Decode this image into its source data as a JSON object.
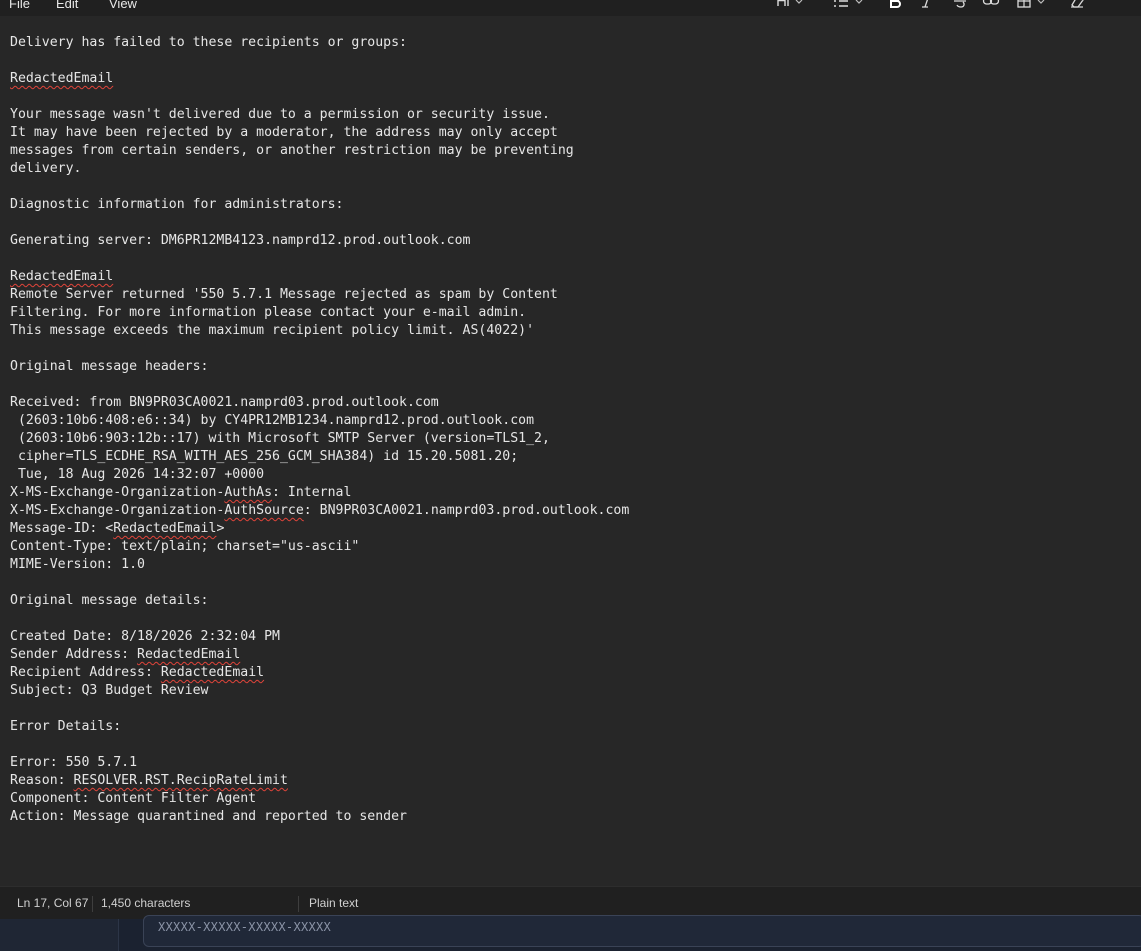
{
  "menu": {
    "file": "File",
    "edit": "Edit",
    "view": "View"
  },
  "toolbar": {
    "heading_icon": "heading-icon",
    "list_icon": "list-icon",
    "bold_icon": "bold-icon",
    "italic_icon": "italic-icon",
    "strikethrough_icon": "strikethrough-icon",
    "link_icon": "link-icon",
    "table_icon": "table-icon",
    "clear_format_icon": "clear-formatting-icon"
  },
  "document": {
    "lines": [
      [
        {
          "t": "Delivery has failed to these recipients or groups:"
        }
      ],
      [],
      [
        {
          "t": "RedactedEmail",
          "sq": true
        }
      ],
      [],
      [
        {
          "t": "Your message wasn't delivered due to a permission or security issue."
        }
      ],
      [
        {
          "t": "It may have been rejected by a moderator, the address may only accept"
        }
      ],
      [
        {
          "t": "messages from certain senders, or another restriction may be preventing"
        }
      ],
      [
        {
          "t": "delivery."
        }
      ],
      [],
      [
        {
          "t": "Diagnostic information for administrators:"
        }
      ],
      [],
      [
        {
          "t": "Generating server: DM6PR12MB4123.namprd12.prod.outlook.com"
        }
      ],
      [],
      [
        {
          "t": "RedactedEmail",
          "sq": true
        }
      ],
      [
        {
          "t": "Remote Server returned '550 5.7.1 Message rejected as spam by Content"
        }
      ],
      [
        {
          "t": "Filtering. For more information please contact your e-mail admin."
        }
      ],
      [
        {
          "t": "This message exceeds the maximum recipient policy limit. AS(4022)'"
        }
      ],
      [],
      [
        {
          "t": "Original message headers:"
        }
      ],
      [],
      [
        {
          "t": "Received: from BN9PR03CA0021.namprd03.prod.outlook.com"
        }
      ],
      [
        {
          "t": " (2603:10b6:408:e6::34) by CY4PR12MB1234.namprd12.prod.outlook.com"
        }
      ],
      [
        {
          "t": " (2603:10b6:903:12b::17) with Microsoft SMTP Server (version=TLS1_2,"
        }
      ],
      [
        {
          "t": " cipher=TLS_ECDHE_RSA_WITH_AES_256_GCM_SHA384) id 15.20.5081.20;"
        }
      ],
      [
        {
          "t": " Tue, 18 Aug 2026 14:32:07 +0000"
        }
      ],
      [
        {
          "t": "X-MS-Exchange-Organization-"
        },
        {
          "t": "AuthAs",
          "sq": true
        },
        {
          "t": ": Internal"
        }
      ],
      [
        {
          "t": "X-MS-Exchange-Organization-"
        },
        {
          "t": "AuthSource",
          "sq": true
        },
        {
          "t": ": BN9PR03CA0021.namprd03.prod.outlook.com"
        }
      ],
      [
        {
          "t": "Message-ID: <"
        },
        {
          "t": "RedactedEmail",
          "sq": true
        },
        {
          "t": ">"
        }
      ],
      [
        {
          "t": "Content-Type: text/plain; charset=\"us-ascii\""
        }
      ],
      [
        {
          "t": "MIME-Version: 1.0"
        }
      ],
      [],
      [
        {
          "t": "Original message details:"
        }
      ],
      [],
      [
        {
          "t": "Created Date: 8/18/2026 2:32:04 PM"
        }
      ],
      [
        {
          "t": "Sender Address: "
        },
        {
          "t": "RedactedEmail",
          "sq": true
        }
      ],
      [
        {
          "t": "Recipient Address: "
        },
        {
          "t": "RedactedEmail",
          "sq": true
        }
      ],
      [
        {
          "t": "Subject: Q3 Budget Review"
        }
      ],
      [],
      [
        {
          "t": "Error Details:"
        }
      ],
      [],
      [
        {
          "t": "Error: 550 5.7.1"
        }
      ],
      [
        {
          "t": "Reason: "
        },
        {
          "t": "RESOLVER.RST.RecipRateLimit",
          "sq": true
        }
      ],
      [
        {
          "t": "Component: Content Filter Agent"
        }
      ],
      [
        {
          "t": "Action: Message quarantined and reported to sender"
        }
      ]
    ]
  },
  "status": {
    "position": "Ln 17, Col 67",
    "characters": "1,450 characters",
    "format": "Plain text"
  },
  "background_window": {
    "field_text": "XXXXX-XXXXX-XXXXX-XXXXX"
  },
  "colors": {
    "background": "#272727",
    "text": "#e6e6e6",
    "spellcheck": "#e0443a",
    "statusbar": "#202020"
  }
}
